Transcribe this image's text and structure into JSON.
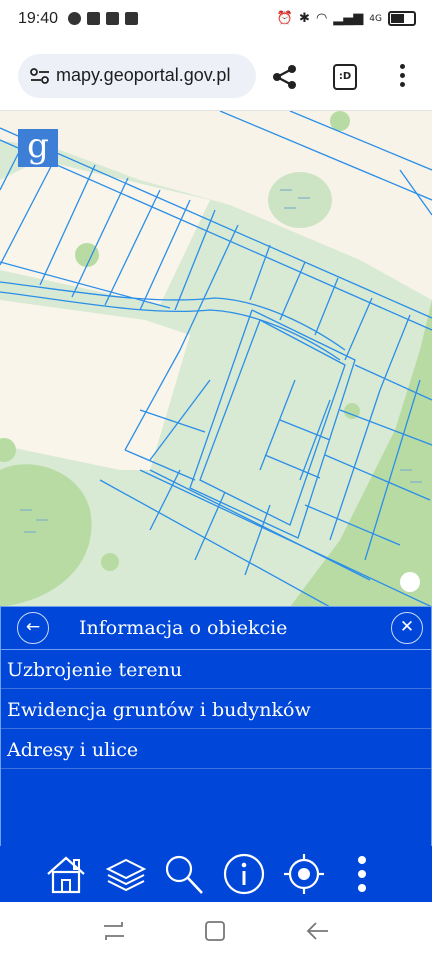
{
  "status_bar": {
    "time": "19:40",
    "network": "4G"
  },
  "browser": {
    "url": "mapy.geoportal.gov.pl",
    "tab_label": ":D"
  },
  "map": {
    "logo_letter": "g"
  },
  "panel": {
    "title": "Informacja o obiekcie",
    "items": [
      {
        "label": "Uzbrojenie terenu"
      },
      {
        "label": "Ewidencja gruntów i budynków"
      },
      {
        "label": "Adresy i ulice"
      }
    ]
  },
  "toolbar": {
    "icons": [
      "home-icon",
      "layers-icon",
      "search-icon",
      "info-icon",
      "locate-icon",
      "more-icon"
    ]
  },
  "colors": {
    "panel": "#0047d9",
    "parcel_line": "#2b8ee8",
    "forest": "#b9dca3",
    "clearing": "#faf4ea"
  }
}
